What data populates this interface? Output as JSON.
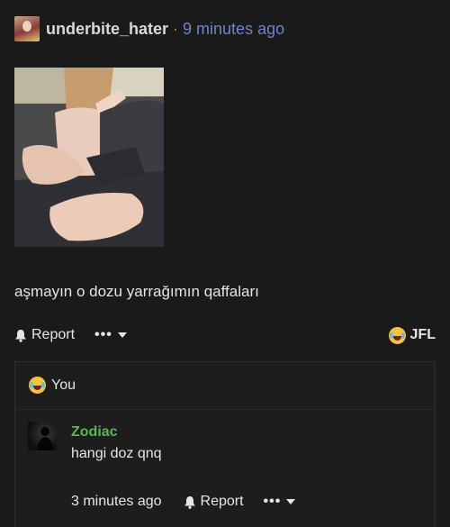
{
  "post": {
    "username": "underbite_hater",
    "separator": "·",
    "time_ago": "9 minutes ago",
    "text": "aşmayın o dozu yarrağımın qaffaları",
    "actions": {
      "report_label": "Report",
      "more_label": "•••",
      "reaction_label": "JFL"
    }
  },
  "reply_section": {
    "reactors_label": "You",
    "comment": {
      "author": "Zodiac",
      "text": "hangi doz qnq",
      "time_ago": "3 minutes ago",
      "report_label": "Report",
      "more_label": "•••"
    }
  },
  "icons": {
    "report": "bell-icon",
    "more": "ellipsis-icon",
    "dropdown": "caret-down-icon",
    "reaction": "tears-of-joy-emoji-icon"
  },
  "colors": {
    "background": "#1a1a1a",
    "time_link": "#6f83c9",
    "comment_author": "#5ab552"
  }
}
